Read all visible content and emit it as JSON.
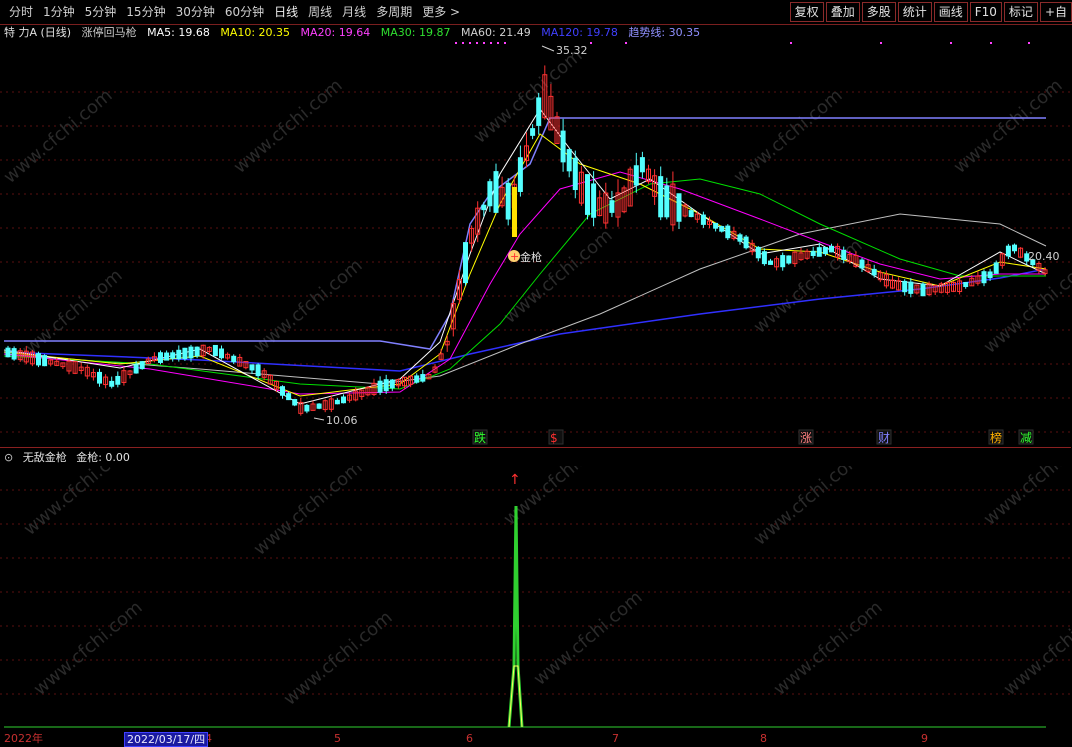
{
  "toolbar": {
    "periods": [
      "分时",
      "1分钟",
      "5分钟",
      "15分钟",
      "30分钟",
      "60分钟",
      "日线",
      "周线",
      "月线",
      "多周期",
      "更多 >"
    ],
    "active": "日线",
    "buttons": [
      "复权",
      "叠加",
      "多股",
      "统计",
      "画线",
      "F10",
      "标记",
      "+自"
    ]
  },
  "info": {
    "stock": "特 力A (日线)",
    "indicator": "涨停回马枪",
    "ma5": "MA5: 19.68",
    "ma10": "MA10: 20.35",
    "ma20": "MA20: 19.64",
    "ma30": "MA30: 19.87",
    "ma60": "MA60: 21.49",
    "ma120": "MA120: 19.78",
    "trend": "趋势线: 30.35"
  },
  "colors": {
    "up": "#ff3232",
    "down": "#54ffff",
    "ma5": "#ffffff",
    "ma10": "#ffff00",
    "ma20": "#ff00ff",
    "ma30": "#00e000",
    "ma60": "#c0c0c0",
    "ma120": "#3030ff",
    "trend": "#8080ff",
    "signal": "#30d030"
  },
  "annotations": {
    "high": "35.32",
    "low": "10.06",
    "right_price": "20.40",
    "signal_label": "金枪",
    "markers": [
      "跌",
      "$",
      "涨",
      "财",
      "榜",
      "减"
    ]
  },
  "sub": {
    "name": "无敌金枪",
    "value": "金枪: 0.00",
    "arrow": "↑"
  },
  "xaxis": {
    "labels": [
      "2022年",
      "4",
      "5",
      "6",
      "7",
      "8",
      "9"
    ],
    "cursor_date": "2022/03/17/四"
  },
  "watermark": "www.cfchi.com"
}
